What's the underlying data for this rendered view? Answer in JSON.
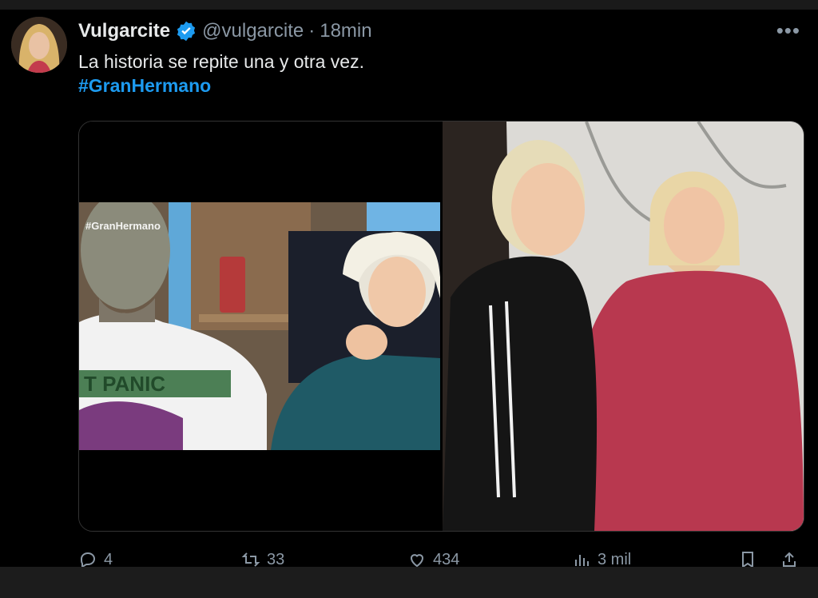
{
  "tweet": {
    "display_name": "Vulgarcite",
    "handle": "@vulgarcite",
    "separator": "·",
    "time": "18min",
    "text": "La historia se repite una y otra vez.",
    "hashtag": "#GranHermano",
    "more_label": "•••"
  },
  "media": {
    "left_watermark": "#GranHermano",
    "left_shirt_text": "T PANIC"
  },
  "actions": {
    "replies": "4",
    "retweets": "33",
    "likes": "434",
    "views": "3 mil"
  },
  "colors": {
    "accent": "#1d9bf0",
    "muted": "#8b98a5",
    "background": "#000000"
  }
}
